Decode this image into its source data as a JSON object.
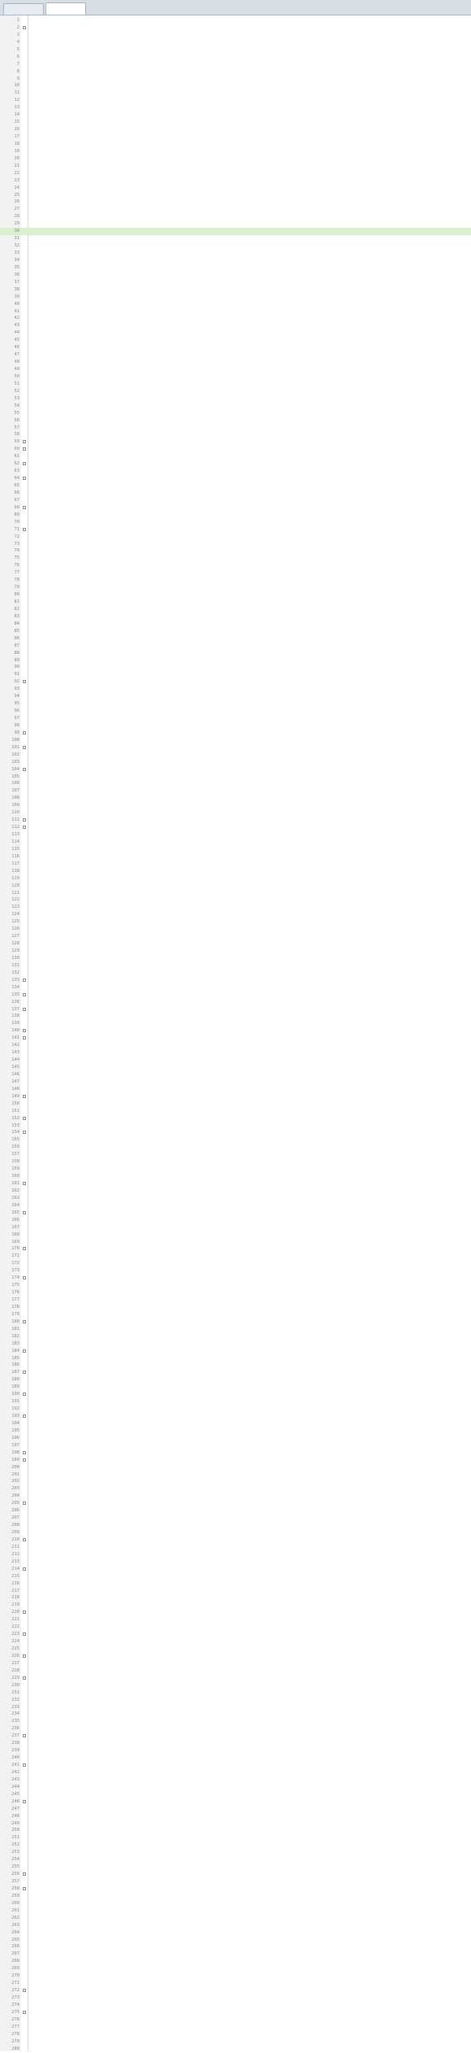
{
  "tabs": [
    {
      "label": "",
      "active": false
    },
    {
      "label": "",
      "active": true
    }
  ],
  "editor": {
    "first_line_number": 1,
    "line_count": 280,
    "highlighted_line": 30,
    "fold_marker_lines": [
      2,
      59,
      60,
      62,
      64,
      68,
      71,
      92,
      99,
      101,
      104,
      111,
      112,
      133,
      135,
      137,
      140,
      141,
      149,
      152,
      154,
      161,
      165,
      170,
      174,
      180,
      184,
      187,
      190,
      193,
      198,
      199,
      205,
      210,
      214,
      220,
      223,
      226,
      229,
      237,
      241,
      246,
      256,
      258,
      272,
      275
    ],
    "lines": []
  },
  "colors": {
    "highlight": "#d9f0d0",
    "comment": "#008000",
    "keyword": "#0000ff",
    "text": "#000000",
    "line_number": "#8a8a8a"
  }
}
